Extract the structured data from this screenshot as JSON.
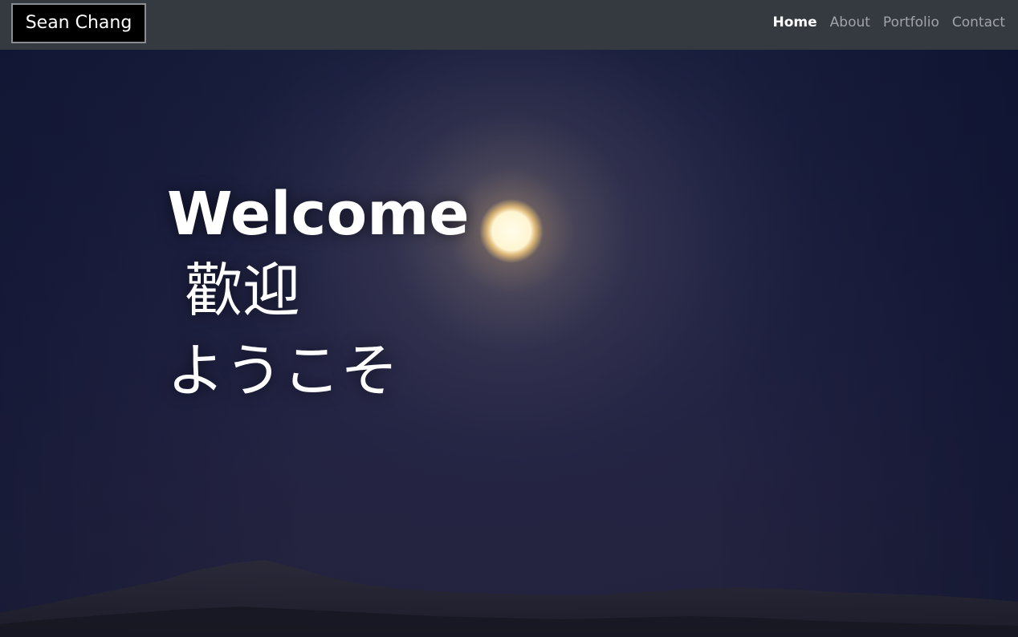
{
  "navbar": {
    "brand": "Sean Chang",
    "links": [
      {
        "label": "Home",
        "active": true
      },
      {
        "label": "About",
        "active": false
      },
      {
        "label": "Portfolio",
        "active": false
      },
      {
        "label": "Contact",
        "active": false
      }
    ]
  },
  "hero": {
    "lines": [
      "Welcome",
      "歡迎",
      "ようこそ"
    ]
  },
  "colors": {
    "navbar_bg": "#343a40",
    "brand_bg": "#000000",
    "active_link": "#ffffff",
    "inactive_link": "#a1a4a8",
    "sky": "#1b1e3d"
  }
}
